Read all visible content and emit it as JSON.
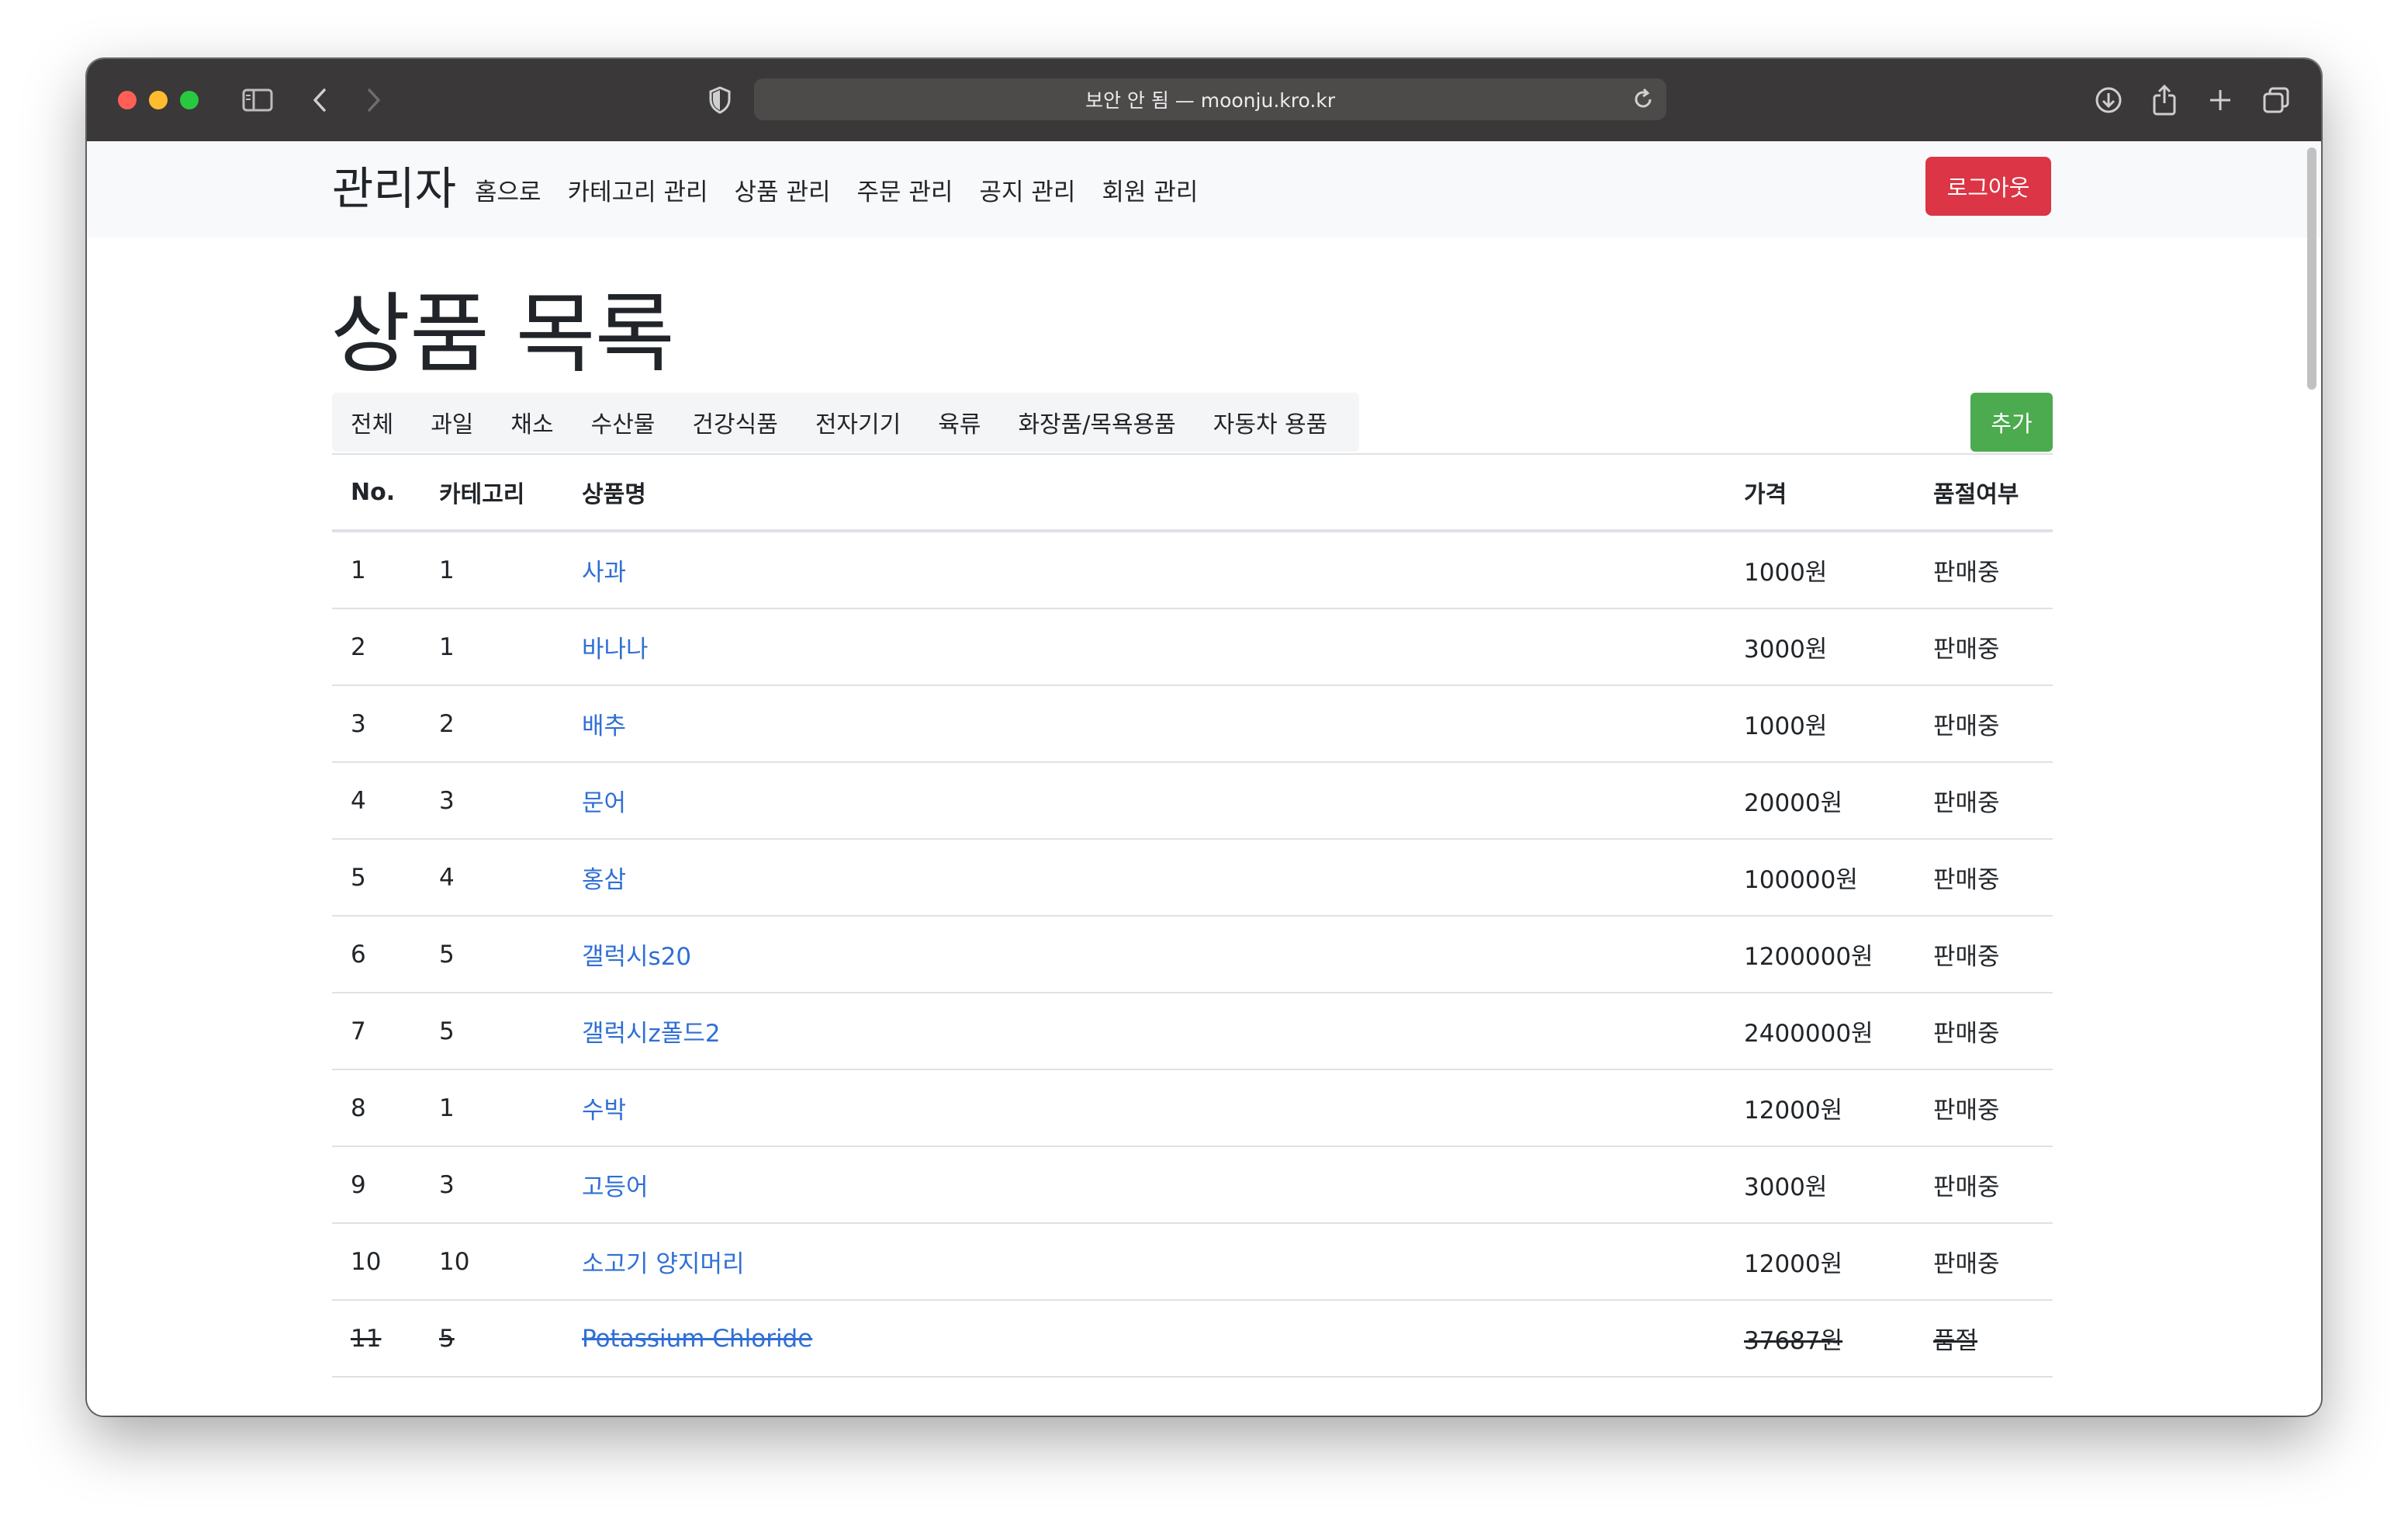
{
  "browser": {
    "url_text": "보안 안 됨 — moonju.kro.kr"
  },
  "navbar": {
    "brand": "관리자",
    "links": [
      "홈으로",
      "카테고리 관리",
      "상품 관리",
      "주문 관리",
      "공지 관리",
      "회원 관리"
    ],
    "logout_label": "로그아웃",
    "logout_color": "#dc3545"
  },
  "page": {
    "title": "상품 목록",
    "categories": [
      "전체",
      "과일",
      "채소",
      "수산물",
      "건강식품",
      "전자기기",
      "육류",
      "화장품/목욕용품",
      "자동차 용품"
    ],
    "add_label": "추가",
    "add_color": "#4caa4f"
  },
  "table": {
    "headers": {
      "no": "No.",
      "category": "카테고리",
      "name": "상품명",
      "price": "가격",
      "stock": "품절여부"
    },
    "rows": [
      {
        "no": "1",
        "category": "1",
        "name": "사과",
        "price": "1000원",
        "stock": "판매중"
      },
      {
        "no": "2",
        "category": "1",
        "name": "바나나",
        "price": "3000원",
        "stock": "판매중"
      },
      {
        "no": "3",
        "category": "2",
        "name": "배추",
        "price": "1000원",
        "stock": "판매중"
      },
      {
        "no": "4",
        "category": "3",
        "name": "문어",
        "price": "20000원",
        "stock": "판매중"
      },
      {
        "no": "5",
        "category": "4",
        "name": "홍삼",
        "price": "100000원",
        "stock": "판매중"
      },
      {
        "no": "6",
        "category": "5",
        "name": "갤럭시s20",
        "price": "1200000원",
        "stock": "판매중"
      },
      {
        "no": "7",
        "category": "5",
        "name": "갤럭시z폴드2",
        "price": "2400000원",
        "stock": "판매중"
      },
      {
        "no": "8",
        "category": "1",
        "name": "수박",
        "price": "12000원",
        "stock": "판매중"
      },
      {
        "no": "9",
        "category": "3",
        "name": "고등어",
        "price": "3000원",
        "stock": "판매중"
      },
      {
        "no": "10",
        "category": "10",
        "name": "소고기 양지머리",
        "price": "12000원",
        "stock": "판매중"
      },
      {
        "no": "11",
        "category": "5",
        "name": "Potassium Chloride",
        "price": "37687원",
        "stock": "품절"
      }
    ]
  }
}
